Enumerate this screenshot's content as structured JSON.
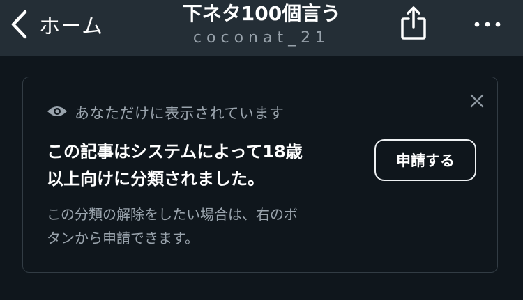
{
  "header": {
    "back_label": "ホーム",
    "title": "下ネタ100個言う",
    "subtitle": "coconat_21",
    "icons": {
      "back": "chevron-left-icon",
      "share": "share-icon",
      "more": "more-horizontal-icon"
    }
  },
  "notice": {
    "visibility_text": "あなただけに表示されています",
    "message_lines": [
      "この記事はシステムによって18歳",
      "以上向けに分類されました。"
    ],
    "sub_message_lines": [
      "この分類の解除をしたい場合は、右のボ",
      "タンから申請できます。"
    ],
    "apply_label": "申請する",
    "icons": {
      "visibility": "eye-icon",
      "close": "close-icon"
    }
  },
  "colors": {
    "header_bg": "#242e36",
    "page_bg": "#0f161c",
    "muted_text": "#9aa4ad",
    "card_border": "#323c44"
  }
}
